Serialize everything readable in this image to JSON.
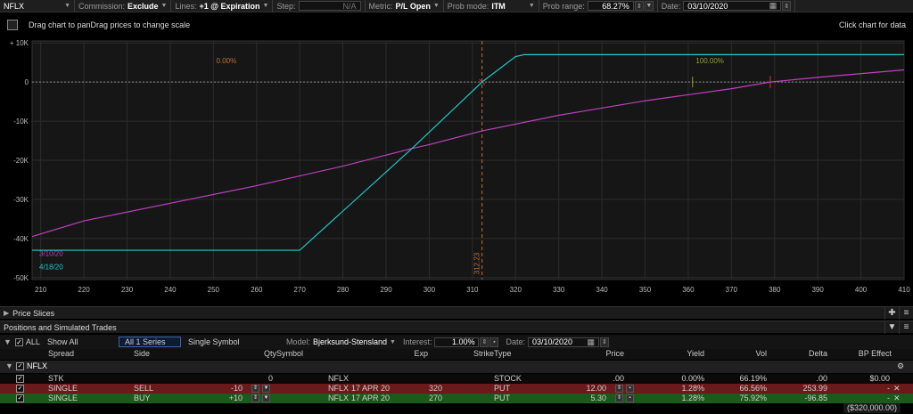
{
  "toolbar": {
    "symbol": "NFLX",
    "commission_label": "Commission:",
    "commission_value": "Exclude",
    "lines_label": "Lines:",
    "lines_value": "+1 @ Expiration",
    "step_label": "Step:",
    "step_value": "N/A",
    "metric_label": "Metric:",
    "metric_value": "P/L Open",
    "prob_mode_label": "Prob mode:",
    "prob_mode_value": "ITM",
    "prob_range_label": "Prob range:",
    "prob_range_value": "68.27%",
    "date_label": "Date:",
    "date_value": "03/10/2020"
  },
  "chart_header": {
    "hint": "Drag chart to panDrag prices to change scale",
    "click_hint": "Click chart for data"
  },
  "chart_data": {
    "type": "line",
    "xlabel": "",
    "ylabel": "",
    "xlim": [
      208,
      410
    ],
    "ylim": [
      -50500,
      10500
    ],
    "x_ticks": [
      210,
      220,
      230,
      240,
      250,
      260,
      270,
      280,
      290,
      300,
      310,
      320,
      330,
      340,
      350,
      360,
      370,
      380,
      390,
      400,
      410
    ],
    "y_ticks": [
      10000,
      0,
      -10000,
      -20000,
      -30000,
      -40000,
      -50000
    ],
    "y_tick_labels": [
      "+ 10K",
      "0",
      "-10K",
      "-20K",
      "-30K",
      "-40K",
      "-50K"
    ],
    "grid": true,
    "series": [
      {
        "name": "3/10/20",
        "color": "#c040c0",
        "x": [
          208,
          220,
          240,
          260,
          280,
          296,
          300,
          312.23,
          330,
          350,
          370,
          379,
          390,
          410
        ],
        "y": [
          -39500,
          -35500,
          -31000,
          -26500,
          -21500,
          -17000,
          -16000,
          -12500,
          -8500,
          -4800,
          -1700,
          0,
          1200,
          3100
        ]
      },
      {
        "name": "4/18/20",
        "color": "#20c8c8",
        "x": [
          208,
          270,
          296,
          312.23,
          320,
          322,
          410
        ],
        "y": [
          -43000,
          -43000,
          -17000,
          0,
          6500,
          7000,
          7000
        ]
      }
    ],
    "annotations": [
      {
        "text": "0.00%",
        "color": "#c07030"
      },
      {
        "text": "100.00%",
        "color": "#90a030"
      },
      {
        "text": "312.23",
        "x": 312.23,
        "color": "#c07030"
      }
    ]
  },
  "sections": {
    "price_slices": "Price Slices",
    "positions": "Positions and Simulated Trades"
  },
  "positions_toolbar": {
    "all_label": "ALL",
    "show_all": "Show All",
    "series": "All 1 Series",
    "single_symbol": "Single Symbol",
    "model_label": "Model:",
    "model_value": "Bjerksund-Stensland",
    "interest_label": "Interest:",
    "interest_value": "1.00%",
    "date_label": "Date:",
    "date_value": "03/10/2020"
  },
  "table": {
    "headers": [
      "Spread",
      "Side",
      "Qty",
      "Symbol",
      "Exp",
      "Strike",
      "Type",
      "Price",
      "Yield",
      "Vol",
      "Delta",
      "BP Effect"
    ],
    "group": "NFLX",
    "rows": [
      {
        "spread": "STK",
        "side": "",
        "qty": "0",
        "symbol": "NFLX",
        "exp": "",
        "strike": "",
        "type": "STOCK",
        "price": ".00",
        "yield": "0.00%",
        "vol": "66.19%",
        "delta": ".00",
        "bp": "$0.00"
      },
      {
        "spread": "SINGLE",
        "side": "SELL",
        "qty": "-10",
        "symbol": "NFLX",
        "exp": "17 APR 20",
        "strike": "320",
        "type": "PUT",
        "price": "12.00",
        "yield": "1.28%",
        "vol": "66.56%",
        "delta": "253.99",
        "bp": "-"
      },
      {
        "spread": "SINGLE",
        "side": "BUY",
        "qty": "+10",
        "symbol": "NFLX",
        "exp": "17 APR 20",
        "strike": "270",
        "type": "PUT",
        "price": "5.30",
        "yield": "1.28%",
        "vol": "75.92%",
        "delta": "-96.85",
        "bp": "-"
      }
    ],
    "total_bp": "($320,000.00)"
  }
}
